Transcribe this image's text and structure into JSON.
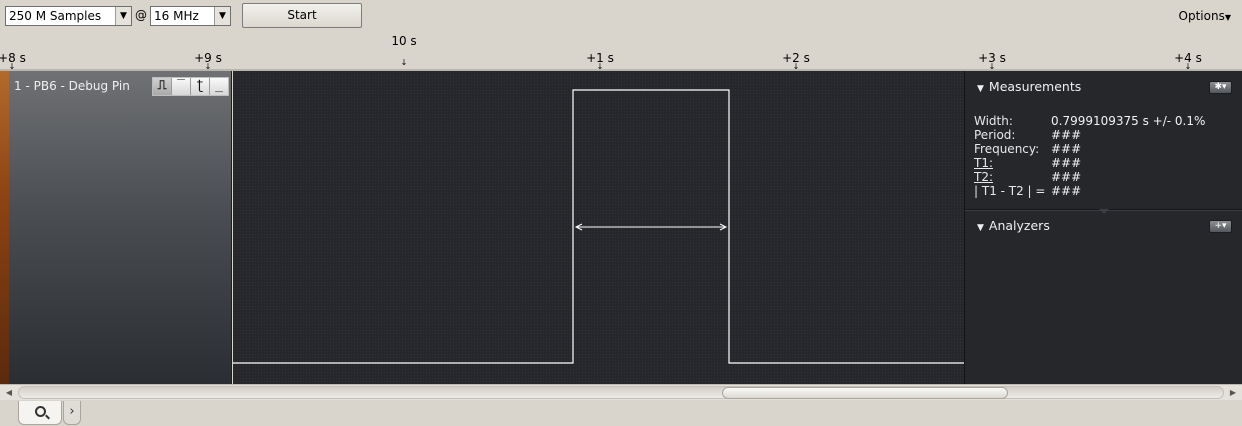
{
  "toolbar": {
    "samples_value": "250 M Samples",
    "at_label": "@",
    "rate_value": "16 MHz",
    "start_label": "Start",
    "options_label": "Options"
  },
  "ruler": {
    "ticks": [
      "+8 s",
      "+9 s",
      "+1 s",
      "+2 s",
      "+3 s",
      "+4 s"
    ],
    "center_label": "10 s"
  },
  "channel": {
    "name": "1 - PB6 - Debug Pin",
    "trigger_buttons": [
      "rising-edge",
      "high-level",
      "falling-edge",
      "low-level"
    ]
  },
  "measurements": {
    "title": "Measurements",
    "rows": [
      {
        "label": "Width:",
        "value": "0.7999109375 s +/- 0.1%"
      },
      {
        "label": "Period:",
        "value": "###"
      },
      {
        "label": "Frequency:",
        "value": "###"
      },
      {
        "label": "T1:",
        "value": "###"
      },
      {
        "label": "T2:",
        "value": "###"
      },
      {
        "label": "| T1 - T2 | =",
        "value": "###"
      }
    ]
  },
  "analyzers": {
    "title": "Analyzers"
  },
  "colors": {
    "background": "#d9d5cd",
    "panel_dark": "#25272b",
    "waveform": "#ffffff",
    "channel_accent": "#8e4314"
  },
  "bottom_tabs": {
    "search_tab": "search-icon",
    "next_tab": "›"
  }
}
